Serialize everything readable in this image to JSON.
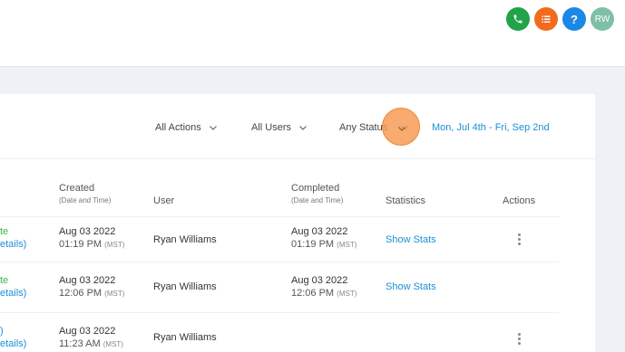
{
  "topbar": {
    "avatar_initials": "RW",
    "help_glyph": "?",
    "icons": [
      "phone-icon",
      "list-icon",
      "help-icon"
    ],
    "colors": {
      "phone": "#22a24a",
      "list": "#f26b1d",
      "help": "#1b88e6",
      "avatar": "#7fbfa6"
    }
  },
  "filters": {
    "actions": "All Actions",
    "users": "All Users",
    "status": "Any Status",
    "date_range": "Mon, Jul 4th - Fri, Sep 2nd"
  },
  "table": {
    "headers": {
      "created": "Created",
      "created_sub": "(Date and Time)",
      "user": "User",
      "completed": "Completed",
      "completed_sub": "(Date and Time)",
      "statistics": "Statistics",
      "actions": "Actions"
    },
    "rows": [
      {
        "status_partial": "te",
        "details_partial": "etails)",
        "created_date": "Aug 03 2022",
        "created_time": "01:19 PM",
        "created_tz": "(MST)",
        "user": "Ryan Williams",
        "completed_date": "Aug 03 2022",
        "completed_time": "01:19 PM",
        "completed_tz": "(MST)",
        "stats": "Show Stats"
      },
      {
        "status_partial": "te",
        "details_partial": "etails)",
        "created_date": "Aug 03 2022",
        "created_time": "12:06 PM",
        "created_tz": "(MST)",
        "user": "Ryan Williams",
        "completed_date": "Aug 03 2022",
        "completed_time": "12:06 PM",
        "completed_tz": "(MST)",
        "stats": "Show Stats"
      },
      {
        "status_partial": ")",
        "details_partial": "etails)",
        "created_date": "Aug 03 2022",
        "created_time": "11:23 AM",
        "created_tz": "(MST)",
        "user": "Ryan Williams",
        "completed_date": "",
        "completed_time": "",
        "completed_tz": "",
        "stats": ""
      }
    ]
  }
}
